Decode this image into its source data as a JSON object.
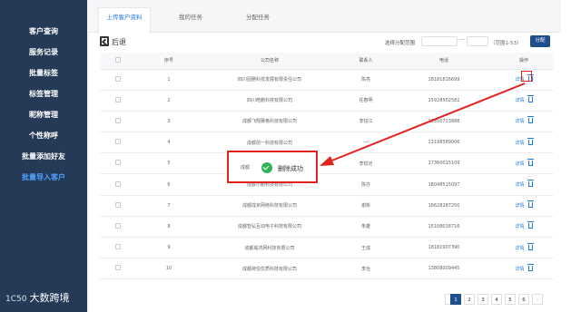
{
  "sidebar": {
    "items": [
      {
        "label": "客户查询"
      },
      {
        "label": "服务记录"
      },
      {
        "label": "批量标签"
      },
      {
        "label": "标签管理"
      },
      {
        "label": "昵称管理"
      },
      {
        "label": "个性称呼"
      },
      {
        "label": "批量添加好友"
      },
      {
        "label": "批量导入客户"
      }
    ],
    "active_index": 7,
    "brand": {
      "logo_text": "1C50",
      "name": "大数跨境"
    }
  },
  "tabs": [
    {
      "label": "上传客户资料"
    },
    {
      "label": "我的任务"
    },
    {
      "label": "分配任务"
    }
  ],
  "toolbar": {
    "back_label": "后退",
    "range_label": "选择分配范围",
    "range_dash": "—",
    "range_hint": "（范围1-53）",
    "assign_label": "分配"
  },
  "table": {
    "headers": [
      "",
      "序号",
      "公司名称",
      "联系人",
      "电话",
      "操作"
    ],
    "detail_label": "详情",
    "rows": [
      {
        "seq": "1",
        "company": "四川固勝科技发展有限责任公司",
        "contact": "陈亮",
        "phone": "18181816699"
      },
      {
        "seq": "2",
        "company": "四川皓鹏科技有限公司",
        "contact": "任春明",
        "phone": "15928502582"
      },
      {
        "seq": "3",
        "company": "成都飞翔赛格科技有限公司",
        "contact": "李钰江",
        "phone": "13550713888"
      },
      {
        "seq": "4",
        "company": "成都前一科技有限公司",
        "contact": "一",
        "phone": "13198589006"
      },
      {
        "seq": "5",
        "company": "",
        "contact": "李轼沧",
        "phone": "17360015109"
      },
      {
        "seq": "6",
        "company": "成都小鹏科技有限公司",
        "contact": "陈亦",
        "phone": "18048515097"
      },
      {
        "seq": "7",
        "company": "成都成京网络科技有限公司",
        "contact": "谢彬",
        "phone": "18628287250"
      },
      {
        "seq": "8",
        "company": "成都智弘互动电子科技有限公司",
        "contact": "朱雄",
        "phone": "15108018716"
      },
      {
        "seq": "9",
        "company": "成都威鸿网科技有限公司",
        "contact": "王成",
        "phone": "18181907390"
      },
      {
        "seq": "10",
        "company": "成都荷信优质科技有限公司",
        "contact": "李治",
        "phone": "13808009445"
      }
    ]
  },
  "toast": {
    "prefix": "成都",
    "message": "删除成功"
  },
  "pagination": {
    "prev": "‹",
    "pages": [
      "1",
      "2",
      "3",
      "4",
      "5",
      "6"
    ],
    "next": "›",
    "current": "1"
  },
  "colors": {
    "sidebar_bg": "#243a57",
    "accent": "#1f7ae0",
    "highlight": "#e0241c",
    "success": "#2fb35a",
    "button_bg": "#1f4e8c"
  }
}
